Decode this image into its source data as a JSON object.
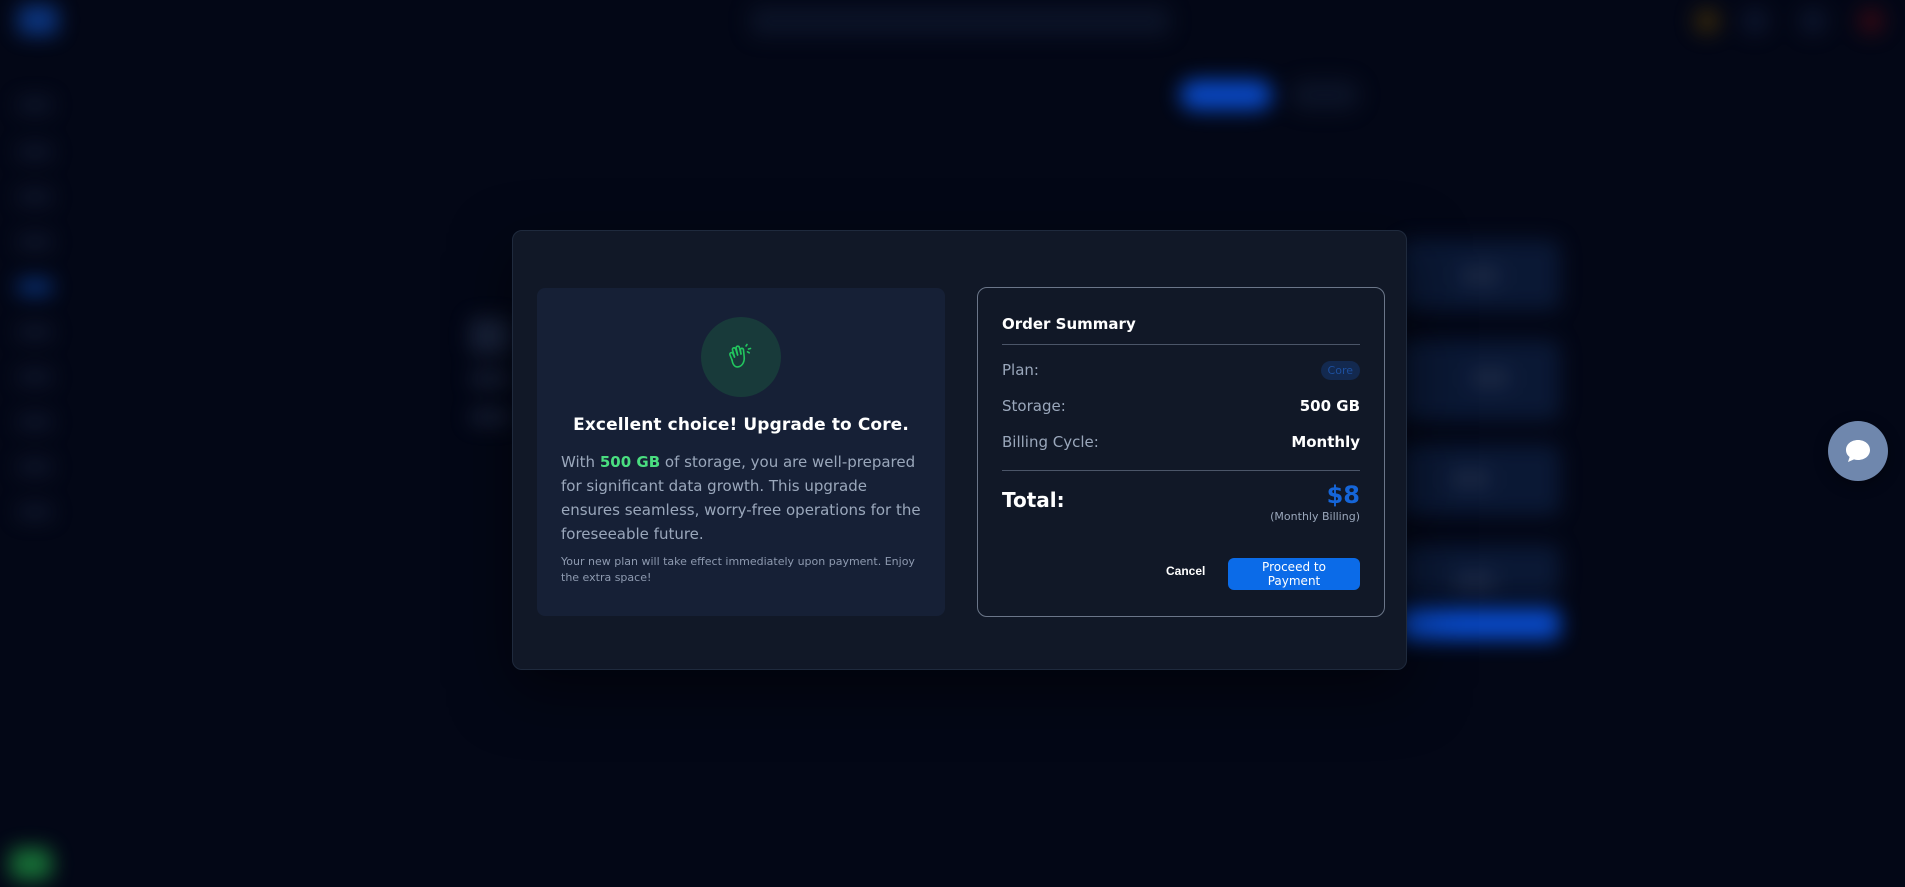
{
  "colors": {
    "page_bg": "#030716",
    "modal_bg": "#111827",
    "accent_blue": "#0b6be8",
    "highlight_green": "#4ade80",
    "total_blue": "#1565d8",
    "chat_bg": "#6f87ad"
  },
  "upgrade": {
    "icon": "waving-hand-icon",
    "headline": "Excellent choice! Upgrade to Core.",
    "desc_prefix": "With",
    "desc_highlight": "500 GB",
    "desc_suffix": "of storage, you are well-prepared for significant data growth. This upgrade ensures seamless, worry-free operations for the foreseeable future.",
    "note": "Your new plan will take effect immediately upon payment. Enjoy the extra space!"
  },
  "order_summary": {
    "title": "Order Summary",
    "plan_label": "Plan:",
    "plan_value": "Core",
    "storage_label": "Storage:",
    "storage_value": "500 GB",
    "billing_label": "Billing Cycle:",
    "billing_value": "Monthly",
    "total_label": "Total:",
    "total_amount": "$8",
    "total_note": "(Monthly Billing)",
    "cancel_label": "Cancel",
    "proceed_label": "Proceed to Payment"
  },
  "chat": {
    "icon": "chat-bubble-icon"
  }
}
